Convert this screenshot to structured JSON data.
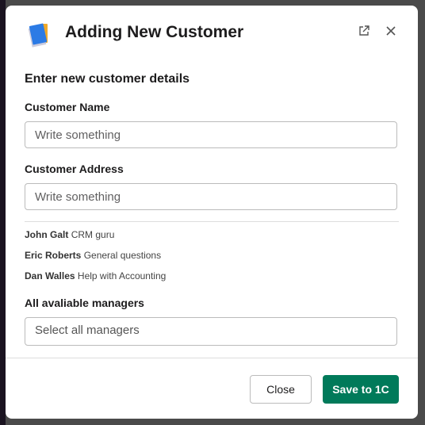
{
  "modal": {
    "title": "Adding New Customer",
    "subtitle": "Enter new customer details",
    "icons": {
      "logo": "notebook-icon",
      "external": "external-link-icon",
      "close": "close-icon"
    }
  },
  "form": {
    "name_label": "Customer Name",
    "name_placeholder": "Write something",
    "address_label": "Customer Address",
    "address_placeholder": "Write something",
    "managers_label": "All avaliable managers",
    "managers_placeholder": "Select all managers"
  },
  "people": [
    {
      "name": "John Galt",
      "role": "CRM guru"
    },
    {
      "name": "Eric Roberts",
      "role": "General questions"
    },
    {
      "name": "Dan Walles",
      "role": "Help with Accounting"
    }
  ],
  "footer": {
    "close_label": "Close",
    "save_label": "Save to 1C",
    "accent": "#007a5a"
  }
}
